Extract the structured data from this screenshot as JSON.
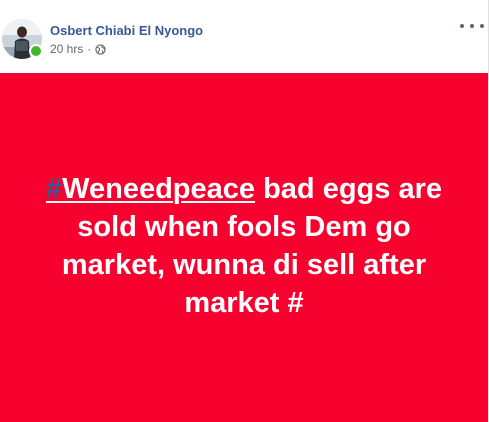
{
  "post": {
    "author": "Osbert Chiabi El Nyongo",
    "time": "20 hrs",
    "separator": "·",
    "audience_icon": "globe-icon",
    "more_icon": "more-options-icon",
    "background_color": "#f7022f",
    "hashtag_symbol": "#",
    "hashtag_word": "Weneedpeace",
    "text_after_hashtag": " bad eggs are sold when fools Dem go market, wunna di sell after market #",
    "online_status": "online"
  }
}
